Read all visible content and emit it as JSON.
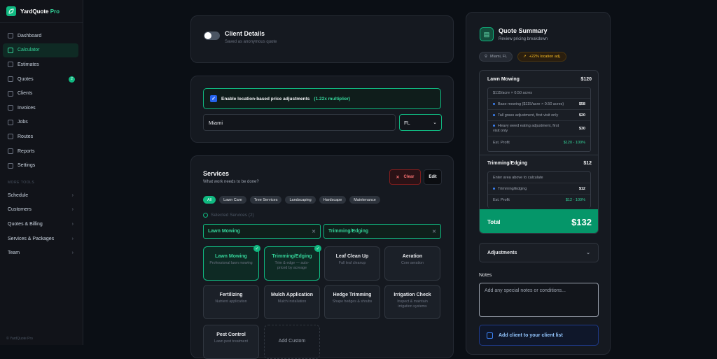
{
  "brand": {
    "name": "YardQuote",
    "suffix": "Pro"
  },
  "nav": [
    {
      "label": "Dashboard",
      "icon": "grid-icon"
    },
    {
      "label": "Calculator",
      "icon": "calculator-icon",
      "active": true
    },
    {
      "label": "Estimates",
      "icon": "clock-icon"
    },
    {
      "label": "Quotes",
      "icon": "document-icon",
      "badge": "2"
    },
    {
      "label": "Clients",
      "icon": "users-icon"
    },
    {
      "label": "Invoices",
      "icon": "dollar-icon"
    },
    {
      "label": "Jobs",
      "icon": "briefcase-icon"
    },
    {
      "label": "Routes",
      "icon": "map-icon"
    },
    {
      "label": "Reports",
      "icon": "chart-icon"
    },
    {
      "label": "Settings",
      "icon": "gear-icon"
    }
  ],
  "more_tools": {
    "heading": "MORE TOOLS",
    "items": [
      "Schedule",
      "Customers",
      "Quotes & Billing",
      "Services & Packages",
      "Team"
    ]
  },
  "footer": "© YardQuote Pro",
  "client": {
    "title": "Client Details",
    "subtitle": "Saved as anonymous quote"
  },
  "location": {
    "checkbox_label": "Enable location-based price adjustments",
    "multiplier": "(1.22x multiplier)",
    "city": "Miami",
    "state": "FL"
  },
  "services": {
    "title": "Services",
    "subtitle": "What work needs to be done?",
    "clear_label": "Clear",
    "edit_label": "Edit",
    "filters": [
      "All",
      "Lawn Care",
      "Tree Services",
      "Landscaping",
      "Hardscape",
      "Maintenance"
    ],
    "selected_heading": "Selected Services (2)",
    "selected": [
      "Lawn Mowing",
      "Trimming/Edging"
    ],
    "cards": [
      {
        "title": "Lawn Mowing",
        "desc": "Professional lawn mowing",
        "selected": true
      },
      {
        "title": "Trimming/Edging",
        "desc": "Trim & edge — auto-priced by acreage",
        "selected": true
      },
      {
        "title": "Leaf Clean Up",
        "desc": "Fall leaf cleanup",
        "selected": false
      },
      {
        "title": "Aeration",
        "desc": "Core aeration",
        "selected": false
      },
      {
        "title": "Fertilizing",
        "desc": "Nutrient application",
        "selected": false
      },
      {
        "title": "Mulch Application",
        "desc": "Mulch installation",
        "selected": false
      },
      {
        "title": "Hedge Trimming",
        "desc": "Shape hedges & shrubs",
        "selected": false
      },
      {
        "title": "Irrigation Check",
        "desc": "Inspect & maintain irrigation systems",
        "selected": false
      },
      {
        "title": "Pest Control",
        "desc": "Lawn pest treatment",
        "selected": false
      }
    ],
    "add_custom": "Add Custom"
  },
  "summary": {
    "title": "Quote Summary",
    "subtitle": "Review pricing breakdown",
    "location": "Miami, FL",
    "location_adj": "+22% location adj.",
    "lawn": {
      "name": "Lawn Mowing",
      "price": "$120",
      "rate": "$115/acre × 0.50 acres",
      "lines": [
        {
          "label": "Base mowing ($115/acre × 0.50 acres)",
          "value": "$58"
        },
        {
          "label": "Tall grass adjustment, first visit only",
          "value": "$20"
        },
        {
          "label": "Heavy weed eating adjustment, first visit only",
          "value": "$30"
        }
      ],
      "profit_label": "Est. Profit",
      "profit": "$120 - 100%"
    },
    "trim": {
      "name": "Trimming/Edging",
      "price": "$12",
      "note": "Enter area above to calculate",
      "line": {
        "label": "Trimming/Edging",
        "value": "$12"
      },
      "profit_label": "Est. Profit",
      "profit": "$12 - 100%"
    },
    "total_label": "Total",
    "total": "$132",
    "adjustments": "Adjustments",
    "notes_label": "Notes",
    "notes_placeholder": "Add any special notes or conditions...",
    "add_client": "Add client to your client list"
  },
  "colors": {
    "accent": "#10b981",
    "bg": "#0b0f15",
    "card": "#151920"
  }
}
